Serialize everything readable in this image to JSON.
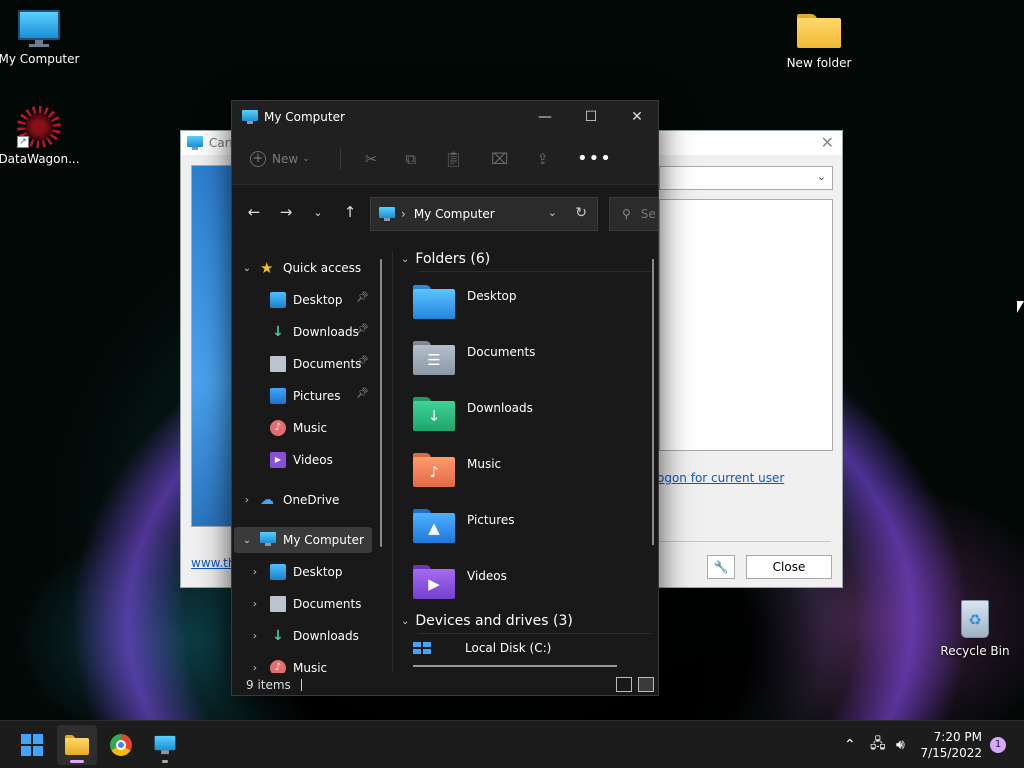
{
  "desktop": {
    "icons": [
      {
        "label": "My Computer"
      },
      {
        "label": "DataWagon..."
      },
      {
        "label": "New folder"
      },
      {
        "label": "Recycle Bin"
      }
    ]
  },
  "bg_dialog": {
    "title": "Carro",
    "link_logon": "ogon for current user",
    "link_site": "www.th",
    "close_label": "Close"
  },
  "explorer": {
    "title": "My Computer",
    "toolbar": {
      "new_label": "New"
    },
    "address": {
      "location": "My Computer"
    },
    "search": {
      "placeholder": "Se"
    },
    "nav": {
      "quick_access": "Quick access",
      "quick_items": [
        {
          "label": "Desktop"
        },
        {
          "label": "Downloads"
        },
        {
          "label": "Documents"
        },
        {
          "label": "Pictures"
        },
        {
          "label": "Music"
        },
        {
          "label": "Videos"
        }
      ],
      "onedrive": "OneDrive",
      "my_computer": "My Computer",
      "computer_items": [
        {
          "label": "Desktop"
        },
        {
          "label": "Documents"
        },
        {
          "label": "Downloads"
        },
        {
          "label": "Music"
        }
      ]
    },
    "content": {
      "folders_header": "Folders (6)",
      "folders": [
        {
          "label": "Desktop",
          "color": "#3fa6ff"
        },
        {
          "label": "Documents",
          "color": "#9aa6b4"
        },
        {
          "label": "Downloads",
          "color": "#2fbf7f"
        },
        {
          "label": "Music",
          "color": "#f0875a"
        },
        {
          "label": "Pictures",
          "color": "#2f8fe6"
        },
        {
          "label": "Videos",
          "color": "#8a4fd8"
        }
      ],
      "drives_header": "Devices and drives (3)",
      "drives": [
        {
          "label": "Local Disk (C:)"
        }
      ]
    },
    "status": {
      "count": "9 items"
    }
  },
  "taskbar": {
    "time": "7:20 PM",
    "date": "7/15/2022",
    "notifications": "1"
  }
}
